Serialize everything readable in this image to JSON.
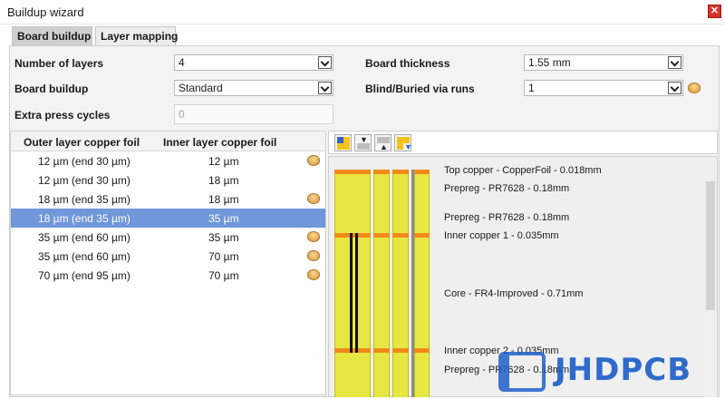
{
  "window": {
    "title": "Buildup wizard"
  },
  "tabs": [
    {
      "label": "Board buildup"
    },
    {
      "label": "Layer mapping"
    }
  ],
  "form": {
    "number_of_layers": {
      "label": "Number of layers",
      "value": "4"
    },
    "board_buildup": {
      "label": "Board buildup",
      "value": "Standard"
    },
    "extra_press_cycles": {
      "label": "Extra press cycles",
      "value": "0"
    },
    "board_thickness": {
      "label": "Board thickness",
      "value": "1.55 mm"
    },
    "blind_buried": {
      "label": "Blind/Buried via runs",
      "value": "1"
    }
  },
  "foil_table": {
    "headers": [
      "Outer layer copper foil",
      "Inner layer copper foil"
    ],
    "rows": [
      {
        "outer": "12 µm (end 30 µm)",
        "inner": "12 µm",
        "coin": true,
        "selected": false
      },
      {
        "outer": "12 µm (end 30 µm)",
        "inner": "18 µm",
        "coin": false,
        "selected": false
      },
      {
        "outer": "18 µm (end 35 µm)",
        "inner": "18 µm",
        "coin": true,
        "selected": false
      },
      {
        "outer": "18 µm (end 35 µm)",
        "inner": "35 µm",
        "coin": false,
        "selected": true
      },
      {
        "outer": "35 µm (end 60 µm)",
        "inner": "35 µm",
        "coin": true,
        "selected": false
      },
      {
        "outer": "35 µm (end 60 µm)",
        "inner": "70 µm",
        "coin": true,
        "selected": false
      },
      {
        "outer": "70 µm (end 95 µm)",
        "inner": "70 µm",
        "coin": true,
        "selected": false
      }
    ]
  },
  "stackup": {
    "layers": [
      "Top copper - CopperFoil - 0.018mm",
      "Prepreg - PR7628 - 0.18mm",
      "Prepreg - PR7628 - 0.18mm",
      "Inner copper 1 - 0.035mm",
      "Core - FR4-Improved - 0.71mm",
      "Inner copper 2 - 0.035mm",
      "Prepreg - PR7628 - 0.18mm"
    ]
  },
  "watermark": {
    "text": "JHDPCB"
  },
  "colors": {
    "selection": "#6f97d9",
    "copper": "#f28a1a",
    "dielectric": "#e7e743",
    "close": "#d9332b",
    "brand": "#1f5fc9"
  }
}
